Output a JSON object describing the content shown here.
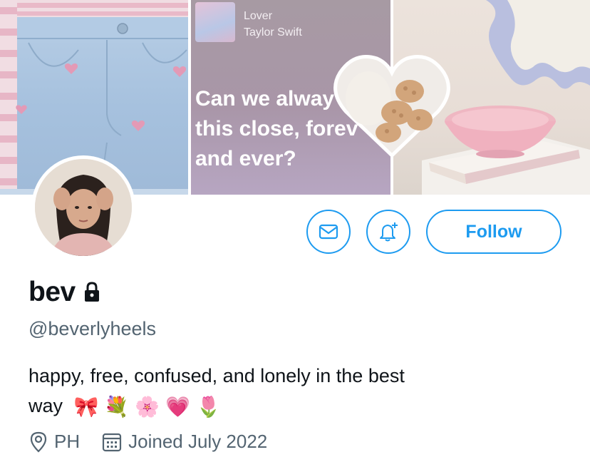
{
  "header": {
    "song": {
      "title": "Lover",
      "artist": "Taylor Swift"
    },
    "lyric": "Can we alway\nthis close, forev\nand ever?"
  },
  "actions": {
    "follow_label": "Follow",
    "message_icon": "mail-icon",
    "notify_icon": "bell-plus-icon"
  },
  "profile": {
    "display_name": "bev",
    "locked_icon": "lock-icon",
    "handle": "@beverlyheels",
    "bio_line1": "happy, free, confused, and lonely in the best",
    "bio_line2": "way",
    "bio_emojis": [
      "🎀",
      "💐",
      "🌸",
      "💗",
      "🌷"
    ],
    "location": "PH",
    "joined": "Joined July 2022"
  },
  "colors": {
    "accent": "#1d9bf0",
    "secondary_text": "#536471",
    "primary_text": "#0f1419"
  }
}
